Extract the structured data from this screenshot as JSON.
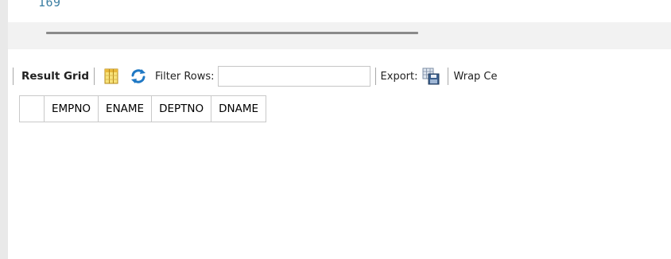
{
  "editor": {
    "line_number": "169"
  },
  "toolbar": {
    "result_grid_label": "Result Grid",
    "filter_label": "Filter Rows:",
    "filter_value": "",
    "export_label": "Export:",
    "wrap_label": "Wrap Ce"
  },
  "grid": {
    "columns": [
      "EMPNO",
      "ENAME",
      "DEPTNO",
      "DNAME"
    ]
  },
  "icons": {
    "columns": "columns-toggle-icon",
    "refresh": "refresh-icon",
    "export": "export-icon"
  },
  "colors": {
    "line_number": "#3d7fa3",
    "refresh": "#1f78c4",
    "columns_icon": "#f0c040"
  }
}
